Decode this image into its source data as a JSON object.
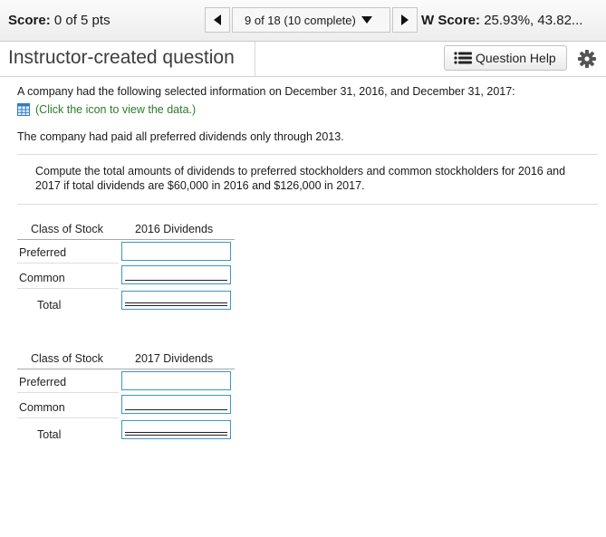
{
  "header": {
    "score_label": "Score:",
    "score_value": "0 of 5 pts",
    "question_selector": "9 of 18 (10 complete)",
    "hw_label": "W Score:",
    "hw_value": "25.93%, 43.82..."
  },
  "titlebar": {
    "title": "Instructor-created question",
    "help_label": "Question Help"
  },
  "question": {
    "intro": "A company had the following selected information on December 31, 2016, and December 31, 2017:",
    "data_link": "(Click the icon to view the data.)",
    "preferred_note": "The company had paid all preferred dividends only through 2013.",
    "instruction": "Compute the total amounts of dividends to preferred stockholders and common stockholders for 2016 and 2017 if total dividends are $60,000 in 2016 and $126,000 in 2017."
  },
  "tables": [
    {
      "class_header": "Class of Stock",
      "year_header": "2016 Dividends",
      "rows": [
        {
          "label": "Preferred",
          "value": ""
        },
        {
          "label": "Common",
          "value": ""
        },
        {
          "label": "Total",
          "value": ""
        }
      ]
    },
    {
      "class_header": "Class of Stock",
      "year_header": "2017 Dividends",
      "rows": [
        {
          "label": "Preferred",
          "value": ""
        },
        {
          "label": "Common",
          "value": ""
        },
        {
          "label": "Total",
          "value": ""
        }
      ]
    }
  ],
  "colors": {
    "link_green": "#2a7d2a",
    "input_border": "#3b97c7",
    "data_icon_blue": "#2f7fc2"
  },
  "icons": [
    "left-arrow-icon",
    "dropdown-caret-icon",
    "right-arrow-icon",
    "list-icon",
    "gear-icon",
    "data-table-icon"
  ]
}
